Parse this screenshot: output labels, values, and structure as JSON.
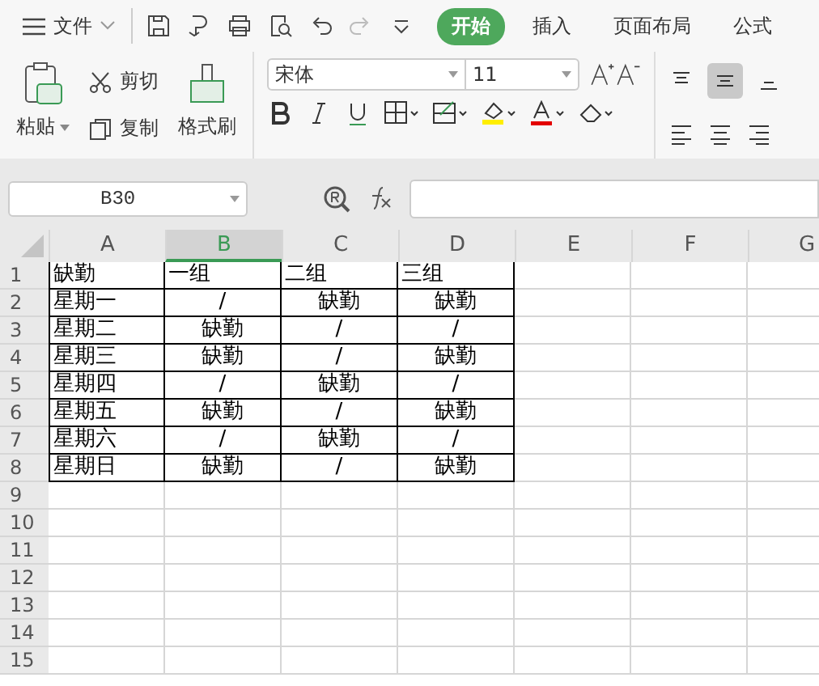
{
  "menu": {
    "file": "文件"
  },
  "tabs": [
    {
      "label": "开始",
      "selected": true
    },
    {
      "label": "插入",
      "selected": false
    },
    {
      "label": "页面布局",
      "selected": false
    },
    {
      "label": "公式",
      "selected": false
    }
  ],
  "ribbon": {
    "paste": "粘贴",
    "cut": "剪切",
    "copy": "复制",
    "format_painter": "格式刷",
    "font": "宋体",
    "font_size": "11"
  },
  "name_box": "B30",
  "columns": [
    {
      "label": "A",
      "selected": false
    },
    {
      "label": "B",
      "selected": true
    },
    {
      "label": "C",
      "selected": false
    },
    {
      "label": "D",
      "selected": false
    },
    {
      "label": "E",
      "selected": false
    },
    {
      "label": "F",
      "selected": false
    },
    {
      "label": "G",
      "selected": false
    }
  ],
  "rows": [
    {
      "number": "1",
      "cells": [
        "缺勤",
        "一组",
        "二组",
        "三组"
      ]
    },
    {
      "number": "2",
      "cells": [
        "星期一",
        "/",
        "缺勤",
        "缺勤"
      ]
    },
    {
      "number": "3",
      "cells": [
        "星期二",
        "缺勤",
        "/",
        "/"
      ]
    },
    {
      "number": "4",
      "cells": [
        "星期三",
        "缺勤",
        "/",
        "缺勤"
      ]
    },
    {
      "number": "5",
      "cells": [
        "星期四",
        "/",
        "缺勤",
        "/"
      ]
    },
    {
      "number": "6",
      "cells": [
        "星期五",
        "缺勤",
        "/",
        "缺勤"
      ]
    },
    {
      "number": "7",
      "cells": [
        "星期六",
        "/",
        "缺勤",
        "/"
      ]
    },
    {
      "number": "8",
      "cells": [
        "星期日",
        "缺勤",
        "/",
        "缺勤"
      ]
    },
    {
      "number": "9",
      "cells": []
    },
    {
      "number": "10",
      "cells": []
    },
    {
      "number": "11",
      "cells": []
    },
    {
      "number": "12",
      "cells": []
    },
    {
      "number": "13",
      "cells": []
    },
    {
      "number": "14",
      "cells": []
    },
    {
      "number": "15",
      "cells": []
    }
  ]
}
